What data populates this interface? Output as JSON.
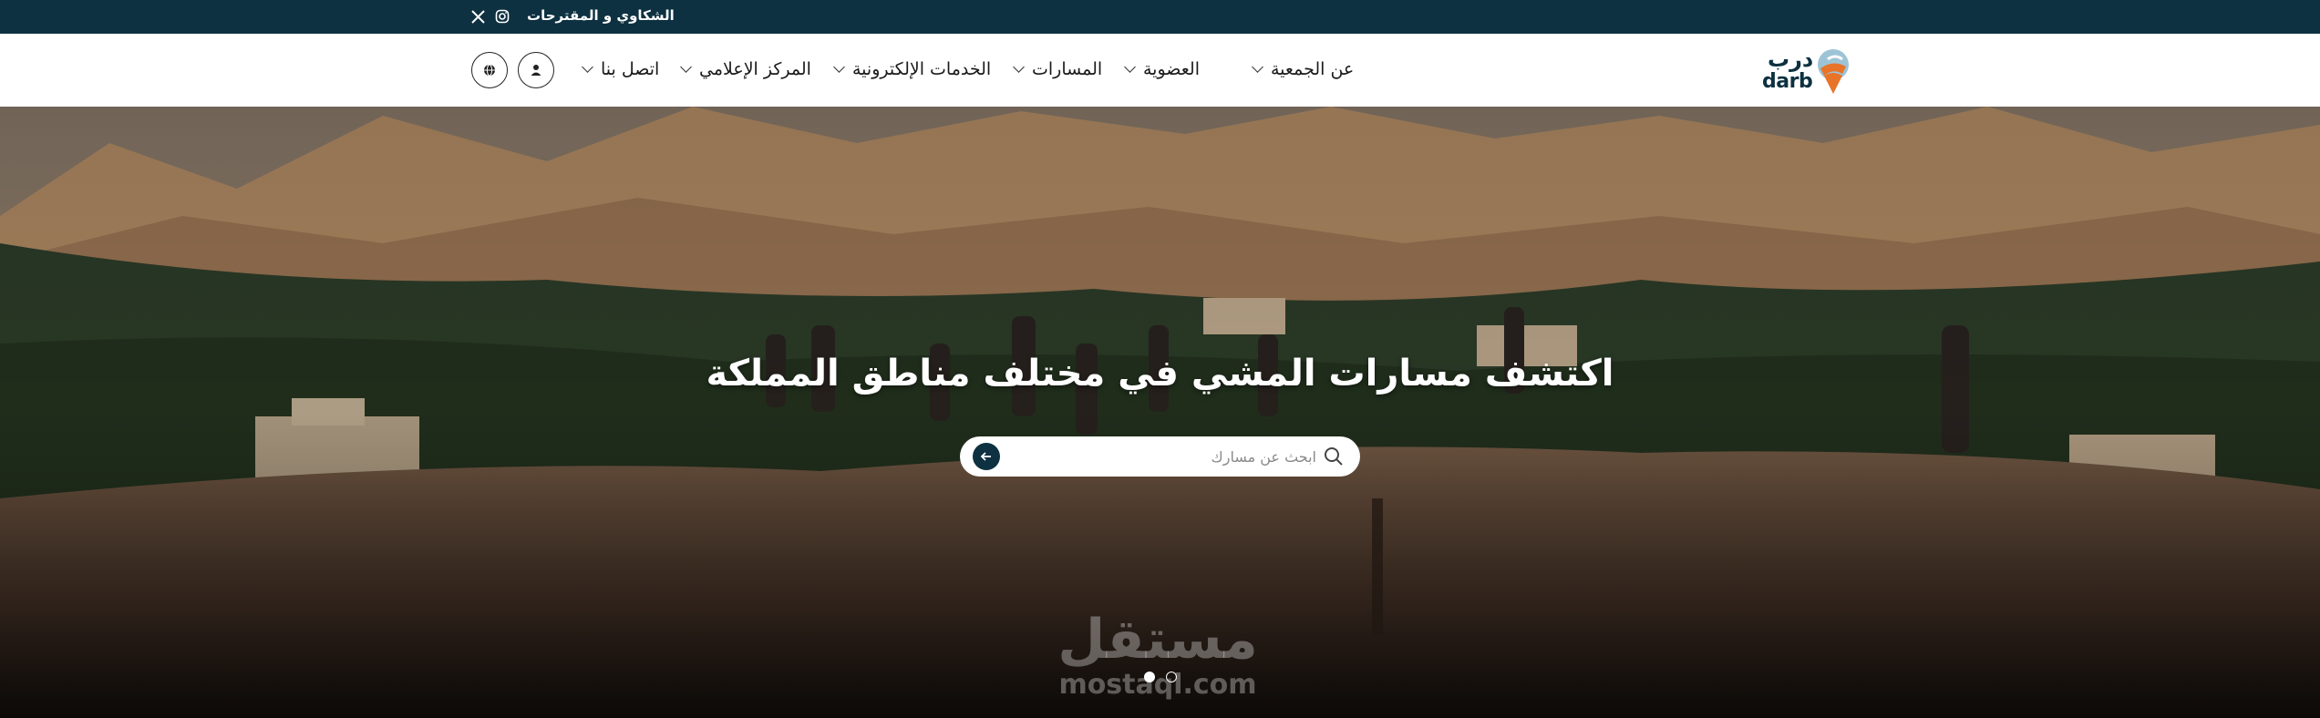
{
  "topbar": {
    "complaints_link": "الشكاوي و المقترحات",
    "social": [
      "instagram-icon",
      "x-icon"
    ],
    "x_glyph": "𝕏"
  },
  "header": {
    "logo": {
      "arabic": "درب",
      "english": "darb"
    },
    "nav": [
      {
        "label": "عن الجمعية",
        "has_dropdown": true
      },
      {
        "label": "العضوية",
        "has_dropdown": true
      },
      {
        "label": "المسارات",
        "has_dropdown": true
      },
      {
        "label": "الخدمات الإلكترونية",
        "has_dropdown": true
      },
      {
        "label": "المركز الإعلامي",
        "has_dropdown": true
      },
      {
        "label": "اتصل بنا",
        "has_dropdown": true
      }
    ],
    "icons": [
      "user-icon",
      "globe-icon"
    ]
  },
  "hero": {
    "title": "اكتشف مسارات المشي في مختلف مناطق المملكة",
    "search": {
      "placeholder": "ابحث عن مسارك",
      "value": ""
    },
    "slider": {
      "total": 2,
      "active": 1
    },
    "watermark": {
      "arabic": "مستقل",
      "english": "mostaql.com"
    }
  },
  "colors": {
    "brand_dark": "#0d3141",
    "brand_orange": "#e8742a",
    "brand_light_blue": "#9dc4d6"
  }
}
